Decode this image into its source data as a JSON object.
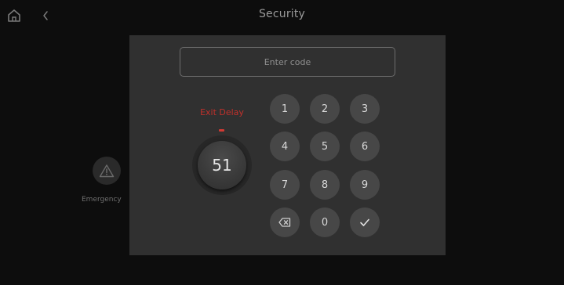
{
  "header": {
    "title": "Security",
    "home_icon": "home-icon",
    "back_icon": "chevron-left-icon"
  },
  "background": {
    "emergency": {
      "label": "Emergency",
      "icon": "warning-triangle-icon"
    }
  },
  "modal": {
    "code_input": {
      "value": "",
      "placeholder": "Enter code"
    },
    "exit_delay": {
      "label": "Exit Delay",
      "seconds": "51"
    },
    "keypad": {
      "k1": "1",
      "k2": "2",
      "k3": "3",
      "k4": "4",
      "k5": "5",
      "k6": "6",
      "k7": "7",
      "k8": "8",
      "k9": "9",
      "k0": "0",
      "backspace_icon": "backspace-icon",
      "confirm_icon": "checkmark-icon"
    }
  },
  "colors": {
    "accent_red": "#c0302b",
    "modal_bg": "#303030",
    "key_bg": "#474747",
    "screen_bg": "#0d0d0d"
  }
}
